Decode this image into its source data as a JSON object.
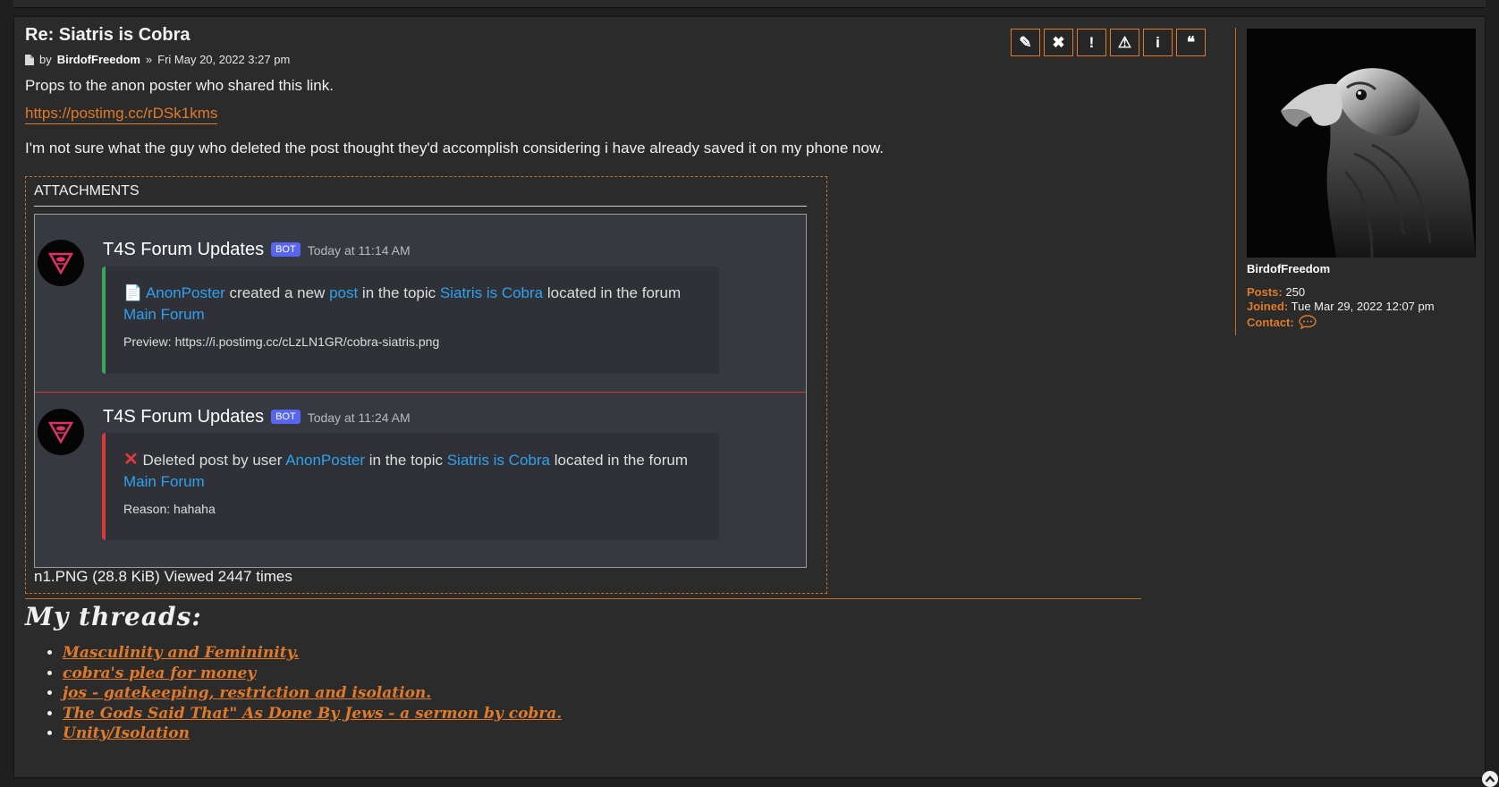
{
  "post": {
    "title": "Re: Siatris is Cobra",
    "byline_prefix": "by",
    "author": "BirdofFreedom",
    "byline_sep": "»",
    "date": "Fri May 20, 2022 3:27 pm",
    "body_line1": "Props to the anon poster who shared this link.",
    "link": "https://postimg.cc/rDSk1kms",
    "body_line2": "I'm not sure what the guy who deleted the post thought they'd accomplish considering i have already saved it on my phone now.",
    "actions": [
      {
        "icon": "pencil-icon",
        "glyph": "✎"
      },
      {
        "icon": "close-icon",
        "glyph": "✖"
      },
      {
        "icon": "exclamation-icon",
        "glyph": "!"
      },
      {
        "icon": "warning-icon",
        "glyph": "⚠"
      },
      {
        "icon": "info-icon",
        "glyph": "i"
      },
      {
        "icon": "quote-icon",
        "glyph": "❝"
      }
    ]
  },
  "attachments": {
    "heading": "ATTACHMENTS",
    "caption": "n1.PNG (28.8 KiB) Viewed 2447 times",
    "messages": [
      {
        "username": "T4S Forum Updates",
        "badge": "BOT",
        "time": "Today at 11:14 AM",
        "parts": {
          "user": "AnonPoster",
          "t1": " created a new ",
          "post_link": "post",
          "t2": " in the topic ",
          "topic": "Siatris is Cobra",
          "t3": " located in the forum ",
          "forum": "Main Forum"
        },
        "sub": "Preview: https://i.postimg.cc/cLzLN1GR/cobra-siatris.png",
        "accent": "#3ba55c"
      },
      {
        "username": "T4S Forum Updates",
        "badge": "BOT",
        "time": "Today at 11:24 AM",
        "parts": {
          "t0": " Deleted post by user ",
          "user": "AnonPoster",
          "t2": " in the topic ",
          "topic": "Siatris is Cobra",
          "t3": " located in the forum ",
          "forum": "Main Forum"
        },
        "sub": "Reason: hahaha",
        "accent": "#d83a3a"
      }
    ]
  },
  "signature": {
    "title": "My threads:",
    "threads": [
      "Masculinity and Femininity.",
      "cobra's plea for money",
      "jos - gatekeeping, restriction and isolation.",
      "The Gods Said That\" As Done By Jews - a sermon by cobra.",
      "Unity/Isolation"
    ]
  },
  "profile": {
    "name": "BirdofFreedom",
    "posts_label": "Posts:",
    "posts": "250",
    "joined_label": "Joined:",
    "joined": "Tue Mar 29, 2022 12:07 pm",
    "contact_label": "Contact:"
  },
  "colors": {
    "accent": "#e07a2b",
    "discord_link": "#2fa1f0",
    "bot_badge": "#5865f2"
  }
}
